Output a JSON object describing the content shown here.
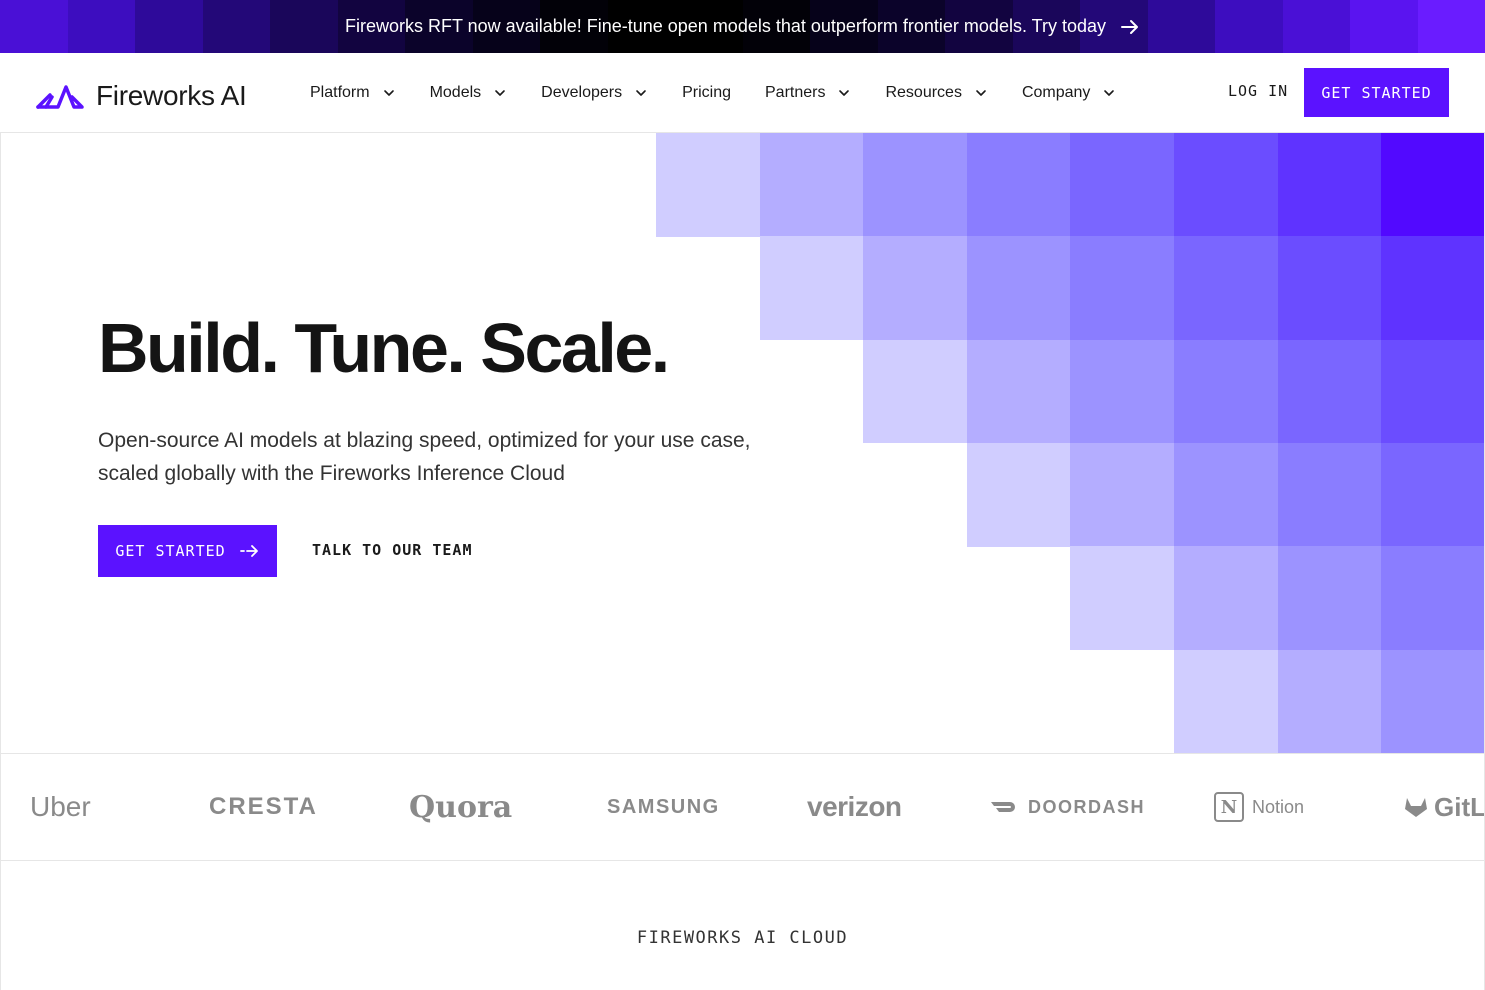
{
  "banner": {
    "text": "Fireworks RFT now available! Fine-tune open models that outperform frontier models. Try today",
    "stripe_colors": [
      "#4a10d6",
      "#3d0dbf",
      "#2e0a9a",
      "#230878",
      "#1a065a",
      "#120440",
      "#0b032a",
      "#06021a",
      "#020108",
      "#000000",
      "#000000",
      "#020108",
      "#06021a",
      "#0b032a",
      "#120440",
      "#1a065a",
      "#230878",
      "#2e0a9a",
      "#3d0dbf",
      "#4a10d6",
      "#5a14f0",
      "#6a1cff"
    ]
  },
  "nav": {
    "logo_text": "Fireworks AI",
    "items": [
      {
        "label": "Platform",
        "dropdown": true
      },
      {
        "label": "Models",
        "dropdown": true
      },
      {
        "label": "Developers",
        "dropdown": true
      },
      {
        "label": "Pricing",
        "dropdown": false
      },
      {
        "label": "Partners",
        "dropdown": true
      },
      {
        "label": "Resources",
        "dropdown": true
      },
      {
        "label": "Company",
        "dropdown": true
      }
    ],
    "login": "LOG IN",
    "cta": "GET STARTED"
  },
  "hero": {
    "title": "Build. Tune. Scale.",
    "subtitle": "Open-source AI models at blazing speed, optimized for your use case, scaled globally with the Fireworks Inference Cloud",
    "cta": "GET STARTED",
    "secondary": "TALK TO OUR TEAM"
  },
  "logos": {
    "uber": "Uber",
    "cresta": "CRESTA",
    "quora": "Quora",
    "samsung": "SAMSUNG",
    "verizon": "verizon",
    "doordash": "DOORDASH",
    "notion": "Notion",
    "gitlab": "GitLab"
  },
  "section": {
    "label": "FIREWORKS AI CLOUD"
  },
  "colors": {
    "accent": "#5b12ff",
    "grid_shades": [
      "#d0cdff",
      "#b4adff",
      "#9c93ff",
      "#8a7dff",
      "#7a66ff",
      "#6b4dff",
      "#5f33ff",
      "#5209ff"
    ]
  },
  "icons": {
    "banner_arrow": "arrow-right-icon",
    "nav_chevron": "chevron-down-icon",
    "cta_arrow": "arrow-dotted-right-icon",
    "logo": "fireworks-logo-icon"
  }
}
